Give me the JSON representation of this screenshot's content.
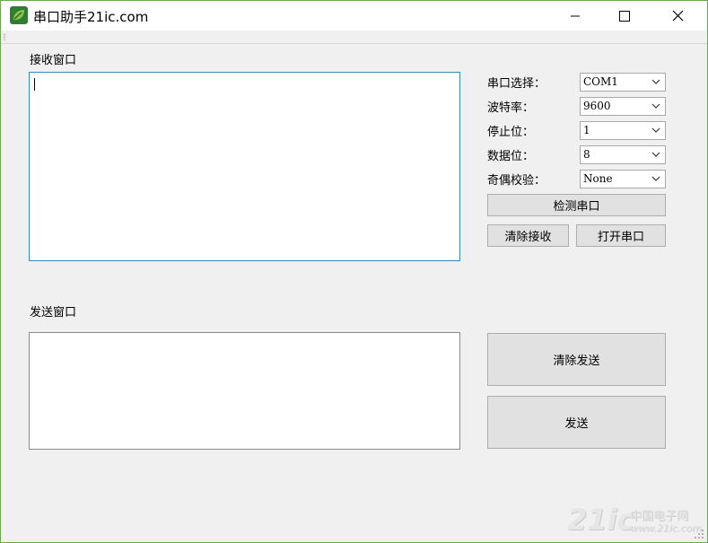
{
  "window": {
    "title": "串口助手21ic.com"
  },
  "receive": {
    "label": "接收窗口",
    "text": ""
  },
  "send": {
    "label": "发送窗口",
    "text": ""
  },
  "settings": {
    "port": {
      "label": "串口选择：",
      "value": "COM1"
    },
    "baud": {
      "label": "波特率：",
      "value": "9600"
    },
    "stop_bits": {
      "label": "停止位：",
      "value": "1"
    },
    "data_bits": {
      "label": "数据位：",
      "value": "8"
    },
    "parity": {
      "label": "奇偶校验：",
      "value": "None"
    }
  },
  "buttons": {
    "detect_port": "检测串口",
    "clear_receive": "清除接收",
    "open_port": "打开串口",
    "clear_send": "清除发送",
    "send": "发送"
  },
  "watermark": {
    "logo": "21ic",
    "name": "中国电子网",
    "url": "www.21ic.com"
  },
  "icons": {
    "app": "leaf-app-icon",
    "minimize": "minimize-icon",
    "maximize": "maximize-icon",
    "close": "close-icon",
    "dropdown": "chevron-down-icon"
  },
  "colors": {
    "window_border": "#6aa84f",
    "receive_box_border": "#3a8bb0",
    "button_face": "#e1e1e1",
    "form_background": "#f0f0f0"
  }
}
